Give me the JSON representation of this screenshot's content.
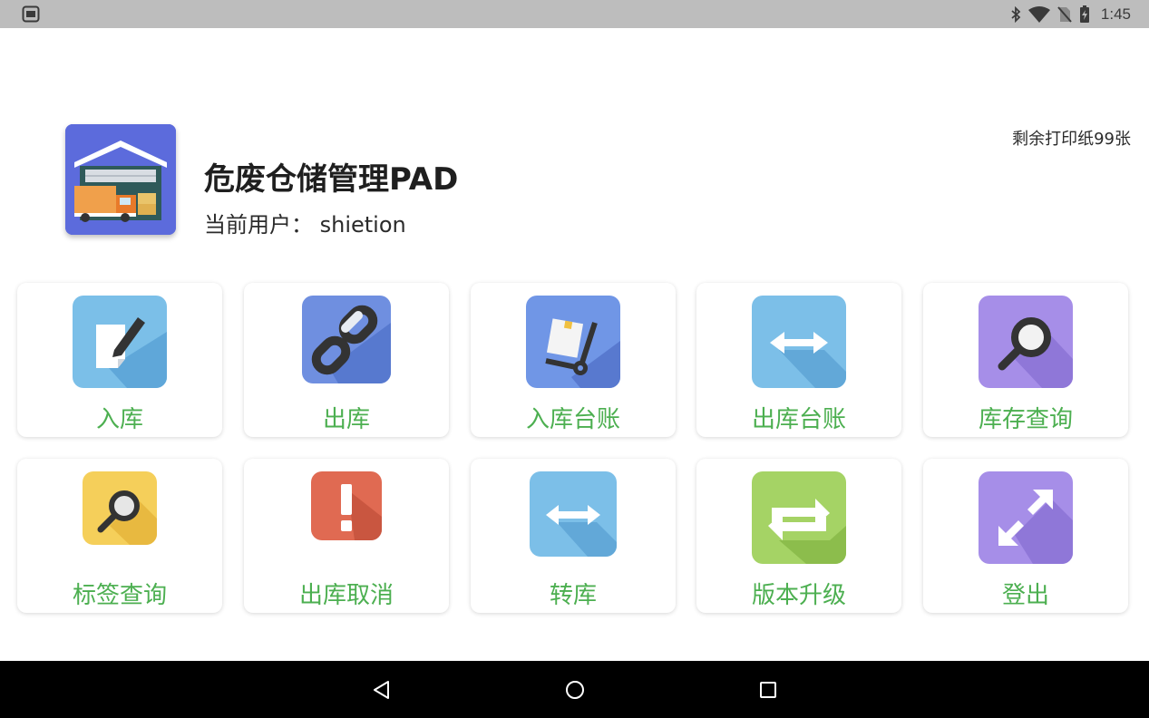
{
  "status_bar": {
    "time": "1:45",
    "icons": [
      "screenshot-icon",
      "bluetooth-icon",
      "wifi-icon",
      "no-sim-icon",
      "battery-charging-icon"
    ]
  },
  "header": {
    "app_title": "危废仓储管理PAD",
    "user_line": "当前用户： shietion",
    "paper_remaining": "剩余打印纸99张"
  },
  "tiles": [
    {
      "label": "入库",
      "icon": "edit-document-icon",
      "color": "#7bbfe8"
    },
    {
      "label": "出库",
      "icon": "chain-link-icon",
      "color": "#6f8fe0"
    },
    {
      "label": "入库台账",
      "icon": "hand-truck-icon",
      "color": "#7096e6"
    },
    {
      "label": "出库台账",
      "icon": "double-arrow-icon",
      "color": "#7cbfe8"
    },
    {
      "label": "库存查询",
      "icon": "magnifier-icon",
      "color": "#a68ee8"
    },
    {
      "label": "标签查询",
      "icon": "magnifier-icon",
      "color": "#f5cf5a"
    },
    {
      "label": "出库取消",
      "icon": "exclamation-icon",
      "color": "#e06a52"
    },
    {
      "label": "转库",
      "icon": "double-arrow-icon",
      "color": "#7cbfe8"
    },
    {
      "label": "版本升级",
      "icon": "refresh-arrows-icon",
      "color": "#a5d365"
    },
    {
      "label": "登出",
      "icon": "expand-arrows-icon",
      "color": "#a68ee8"
    }
  ],
  "colors": {
    "label_green": "#4caf50",
    "logo_bg": "#5c6bdc",
    "status_bar_bg": "#bdbdbd",
    "nav_bar_bg": "#000000"
  },
  "nav_bar": {
    "buttons": [
      "back-icon",
      "home-icon",
      "recents-icon"
    ]
  }
}
